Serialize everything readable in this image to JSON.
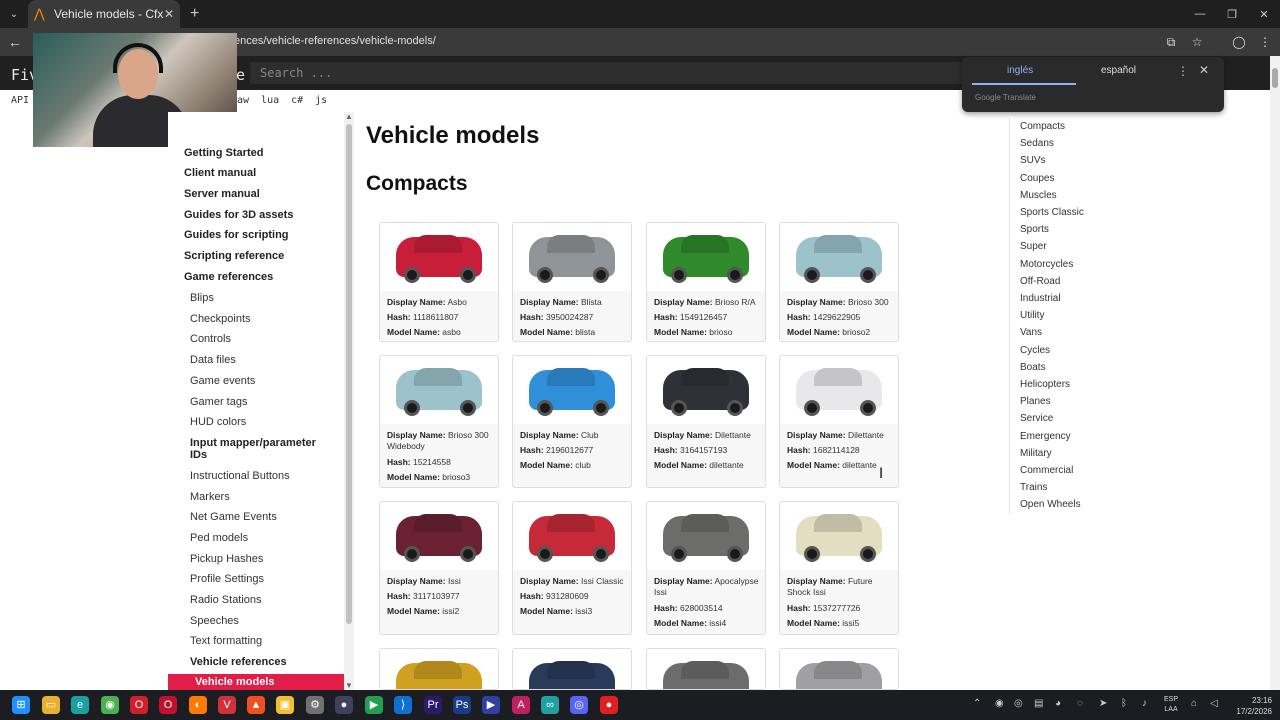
{
  "browser": {
    "tab_title": "Vehicle models - Cfx.re Docs",
    "url": "ences/vehicle-references/vehicle-models/",
    "new_tab": "+",
    "tab_close": "✕"
  },
  "site": {
    "brand": "Fiv",
    "brand_tail": "e",
    "search_placeholder": "Search ...",
    "api_label": "API",
    "lang_links": [
      "aw",
      "lua",
      "c#",
      "js"
    ]
  },
  "translate": {
    "lang_from": "inglés",
    "lang_to": "español",
    "google": "Google Translate"
  },
  "sidebar": {
    "items": [
      {
        "label": "Getting Started",
        "style": "bold"
      },
      {
        "label": "Client manual",
        "style": "bold"
      },
      {
        "label": "Server manual",
        "style": "bold"
      },
      {
        "label": "Guides for 3D assets",
        "style": "bold"
      },
      {
        "label": "Guides for scripting",
        "style": "bold"
      },
      {
        "label": "Scripting reference",
        "style": "bold"
      },
      {
        "label": "Game references",
        "style": "bold"
      },
      {
        "label": "Blips",
        "style": "sub"
      },
      {
        "label": "Checkpoints",
        "style": "sub"
      },
      {
        "label": "Controls",
        "style": "sub"
      },
      {
        "label": "Data files",
        "style": "sub"
      },
      {
        "label": "Game events",
        "style": "sub"
      },
      {
        "label": "Gamer tags",
        "style": "sub"
      },
      {
        "label": "HUD colors",
        "style": "sub"
      },
      {
        "label": "Input mapper/parameter",
        "style": "subbold"
      },
      {
        "label": "IDs",
        "style": "subbold"
      },
      {
        "label": "Instructional Buttons",
        "style": "sub"
      },
      {
        "label": "Markers",
        "style": "sub"
      },
      {
        "label": "Net Game Events",
        "style": "sub"
      },
      {
        "label": "Ped models",
        "style": "sub"
      },
      {
        "label": "Pickup Hashes",
        "style": "sub"
      },
      {
        "label": "Profile Settings",
        "style": "sub"
      },
      {
        "label": "Radio Stations",
        "style": "sub"
      },
      {
        "label": "Speeches",
        "style": "sub"
      },
      {
        "label": "Text formatting",
        "style": "sub"
      },
      {
        "label": "Vehicle references",
        "style": "subbold"
      }
    ],
    "active": "Vehicle models"
  },
  "main": {
    "title": "Vehicle models",
    "section": "Compacts",
    "labels": {
      "display": "Display Name:",
      "hash": "Hash:",
      "model": "Model Name:"
    },
    "cards": [
      {
        "display": "Asbo",
        "hash": "1118611807",
        "model": "asbo",
        "color": "#c81e3a"
      },
      {
        "display": "Blista",
        "hash": "3950024287",
        "model": "blista",
        "color": "#8f9498"
      },
      {
        "display": "Brioso R/A",
        "hash": "1549126457",
        "model": "brioso",
        "color": "#2e8a2a"
      },
      {
        "display": "Brioso 300",
        "hash": "1429622905",
        "model": "brioso2",
        "color": "#9cc2cc"
      },
      {
        "display": "Brioso 300",
        "display2": "Widebody",
        "hash": "15214558",
        "model": "brioso3",
        "color": "#9cc2cc"
      },
      {
        "display": "Club",
        "hash": "2196012677",
        "model": "club",
        "color": "#2f8fd8"
      },
      {
        "display": "Dilettante",
        "hash": "3164157193",
        "model": "dilettante",
        "color": "#2e3136"
      },
      {
        "display": "Dilettante",
        "hash": "1682114128",
        "model": "dilettante",
        "color": "#e8e8ea"
      },
      {
        "display": "Issi",
        "hash": "3117103977",
        "model": "issi2",
        "color": "#6a2232"
      },
      {
        "display": "Issi Classic",
        "hash": "931280609",
        "model": "issi3",
        "color": "#c62a38"
      },
      {
        "display": "Apocalypse",
        "display2": "Issi",
        "hash": "628003514",
        "model": "issi4",
        "color": "#6c6c6a"
      },
      {
        "display": "Future",
        "display2": "Shock Issi",
        "hash": "1537277726",
        "model": "issi5",
        "color": "#e3ddc2"
      },
      {
        "color": "#d0a020"
      },
      {
        "color": "#2a3a5a"
      },
      {
        "color": "#6c6c6c"
      },
      {
        "color": "#a0a0a4"
      }
    ]
  },
  "toc": [
    "Compacts",
    "Sedans",
    "SUVs",
    "Coupes",
    "Muscles",
    "Sports Classic",
    "Sports",
    "Super",
    "Motorcycles",
    "Off-Road",
    "Industrial",
    "Utility",
    "Vans",
    "Cycles",
    "Boats",
    "Helicopters",
    "Planes",
    "Service",
    "Emergency",
    "Military",
    "Commercial",
    "Trains",
    "Open Wheels"
  ],
  "taskbar": {
    "lang": "ESP",
    "lang2": "LAA",
    "time": "23:16",
    "date": "17/2/2026"
  },
  "colors": {
    "accent": "#e11d48",
    "header_bg": "#202020"
  }
}
